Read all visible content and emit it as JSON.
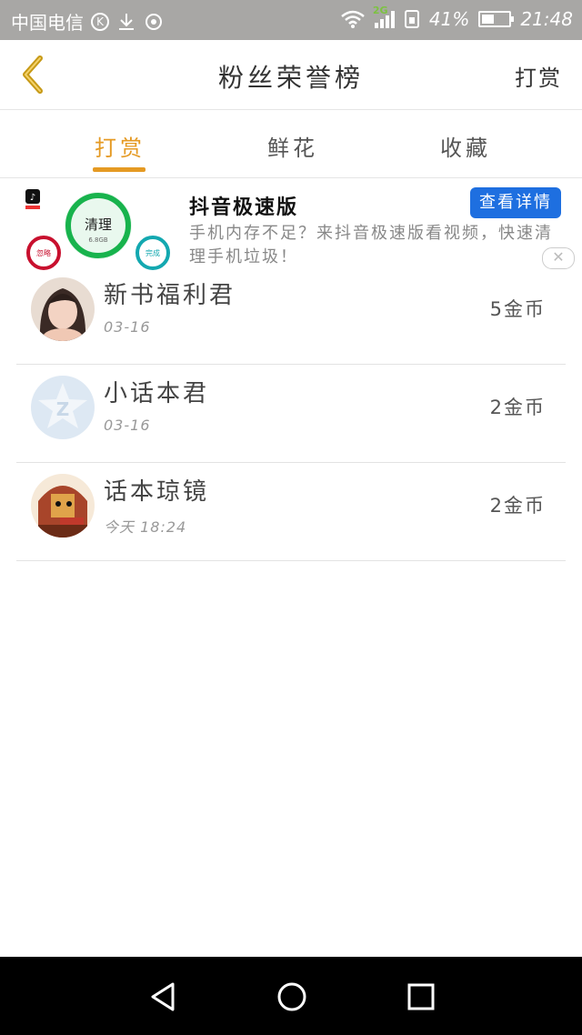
{
  "status_bar": {
    "carrier": "中国电信",
    "network_tag": "2G",
    "battery": "41%",
    "battery_level": 0.41,
    "time": "21:48"
  },
  "header": {
    "title": "粉丝荣誉榜",
    "right_action": "打赏"
  },
  "tabs": [
    {
      "label": "打赏",
      "active": true
    },
    {
      "label": "鲜花",
      "active": false
    },
    {
      "label": "收藏",
      "active": false
    }
  ],
  "ad": {
    "title": "抖音极速版",
    "description": "手机内存不足？来抖音极速版看视频，快速清理手机垃圾！",
    "button": "查看详情",
    "close": "✕",
    "graphic_main": "清理",
    "graphic_size": "6.8GB",
    "graphic_left": "忽略",
    "graphic_right": "完成"
  },
  "fans": [
    {
      "name": "新书福利君",
      "date": "03-16",
      "coins": "5金币"
    },
    {
      "name": "小话本君",
      "date": "03-16",
      "coins": "2金币"
    },
    {
      "name": "话本琼镜",
      "date": "今天  18:24",
      "coins": "2金币"
    }
  ],
  "colors": {
    "accent": "#e59a23",
    "ad_button": "#1e6fe0",
    "status_bar": "#a8a7a5"
  },
  "icons": {
    "back": "chevron-left-icon",
    "nav_back": "triangle-back-icon",
    "nav_home": "circle-home-icon",
    "nav_recents": "square-recents-icon"
  }
}
